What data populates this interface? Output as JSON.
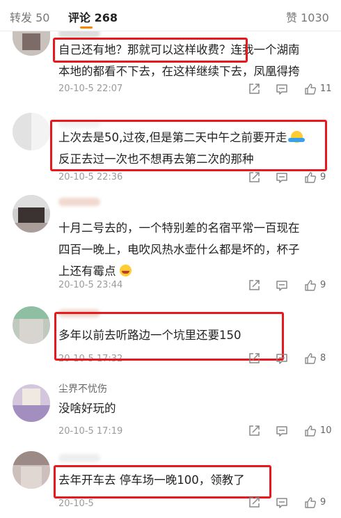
{
  "tabs": {
    "repost": "转发 50",
    "comments": "评论 268",
    "likes": "赞 1030"
  },
  "comments": [
    {
      "line1": "自己还有地？那就可以这样收费？连我一个湖南",
      "line2": "本地的都看不下去，在这样继续下去，凤凰得挎",
      "time": "20-10-5 22:07",
      "likes": "11"
    },
    {
      "line1": "上次去是50,过夜,但是第二天中午之前要开走",
      "line2": "反正去过一次也不想再去第二次的那种",
      "time": "20-10-5 22:36",
      "likes": "9"
    },
    {
      "line1": "十月二号去的，一个特别差的名宿平常一百现在",
      "line2": "四百一晚上，电吹风热水壶什么都是坏的，杯子",
      "line3": "上还有霉点",
      "time": "20-10-5 23:44",
      "likes": "9"
    },
    {
      "line1": "多年以前去听路边一个坑里还要150",
      "time": "20-10-5 17:32",
      "likes": "8"
    },
    {
      "username": "尘界不忧伤",
      "line1": "没啥好玩的",
      "time": "20-10-5 17:19",
      "likes": "10"
    },
    {
      "line1": "去年开车去 停车场一晚100，领教了",
      "time": "20-10-5",
      "likes": "9"
    }
  ],
  "icons": [
    "repost-icon",
    "reply-icon",
    "like-icon",
    "emoji-cold-sweat",
    "emoji-crying-laughing"
  ],
  "colors": {
    "accent": "#ff8200",
    "highlight_box": "#e8191c"
  }
}
